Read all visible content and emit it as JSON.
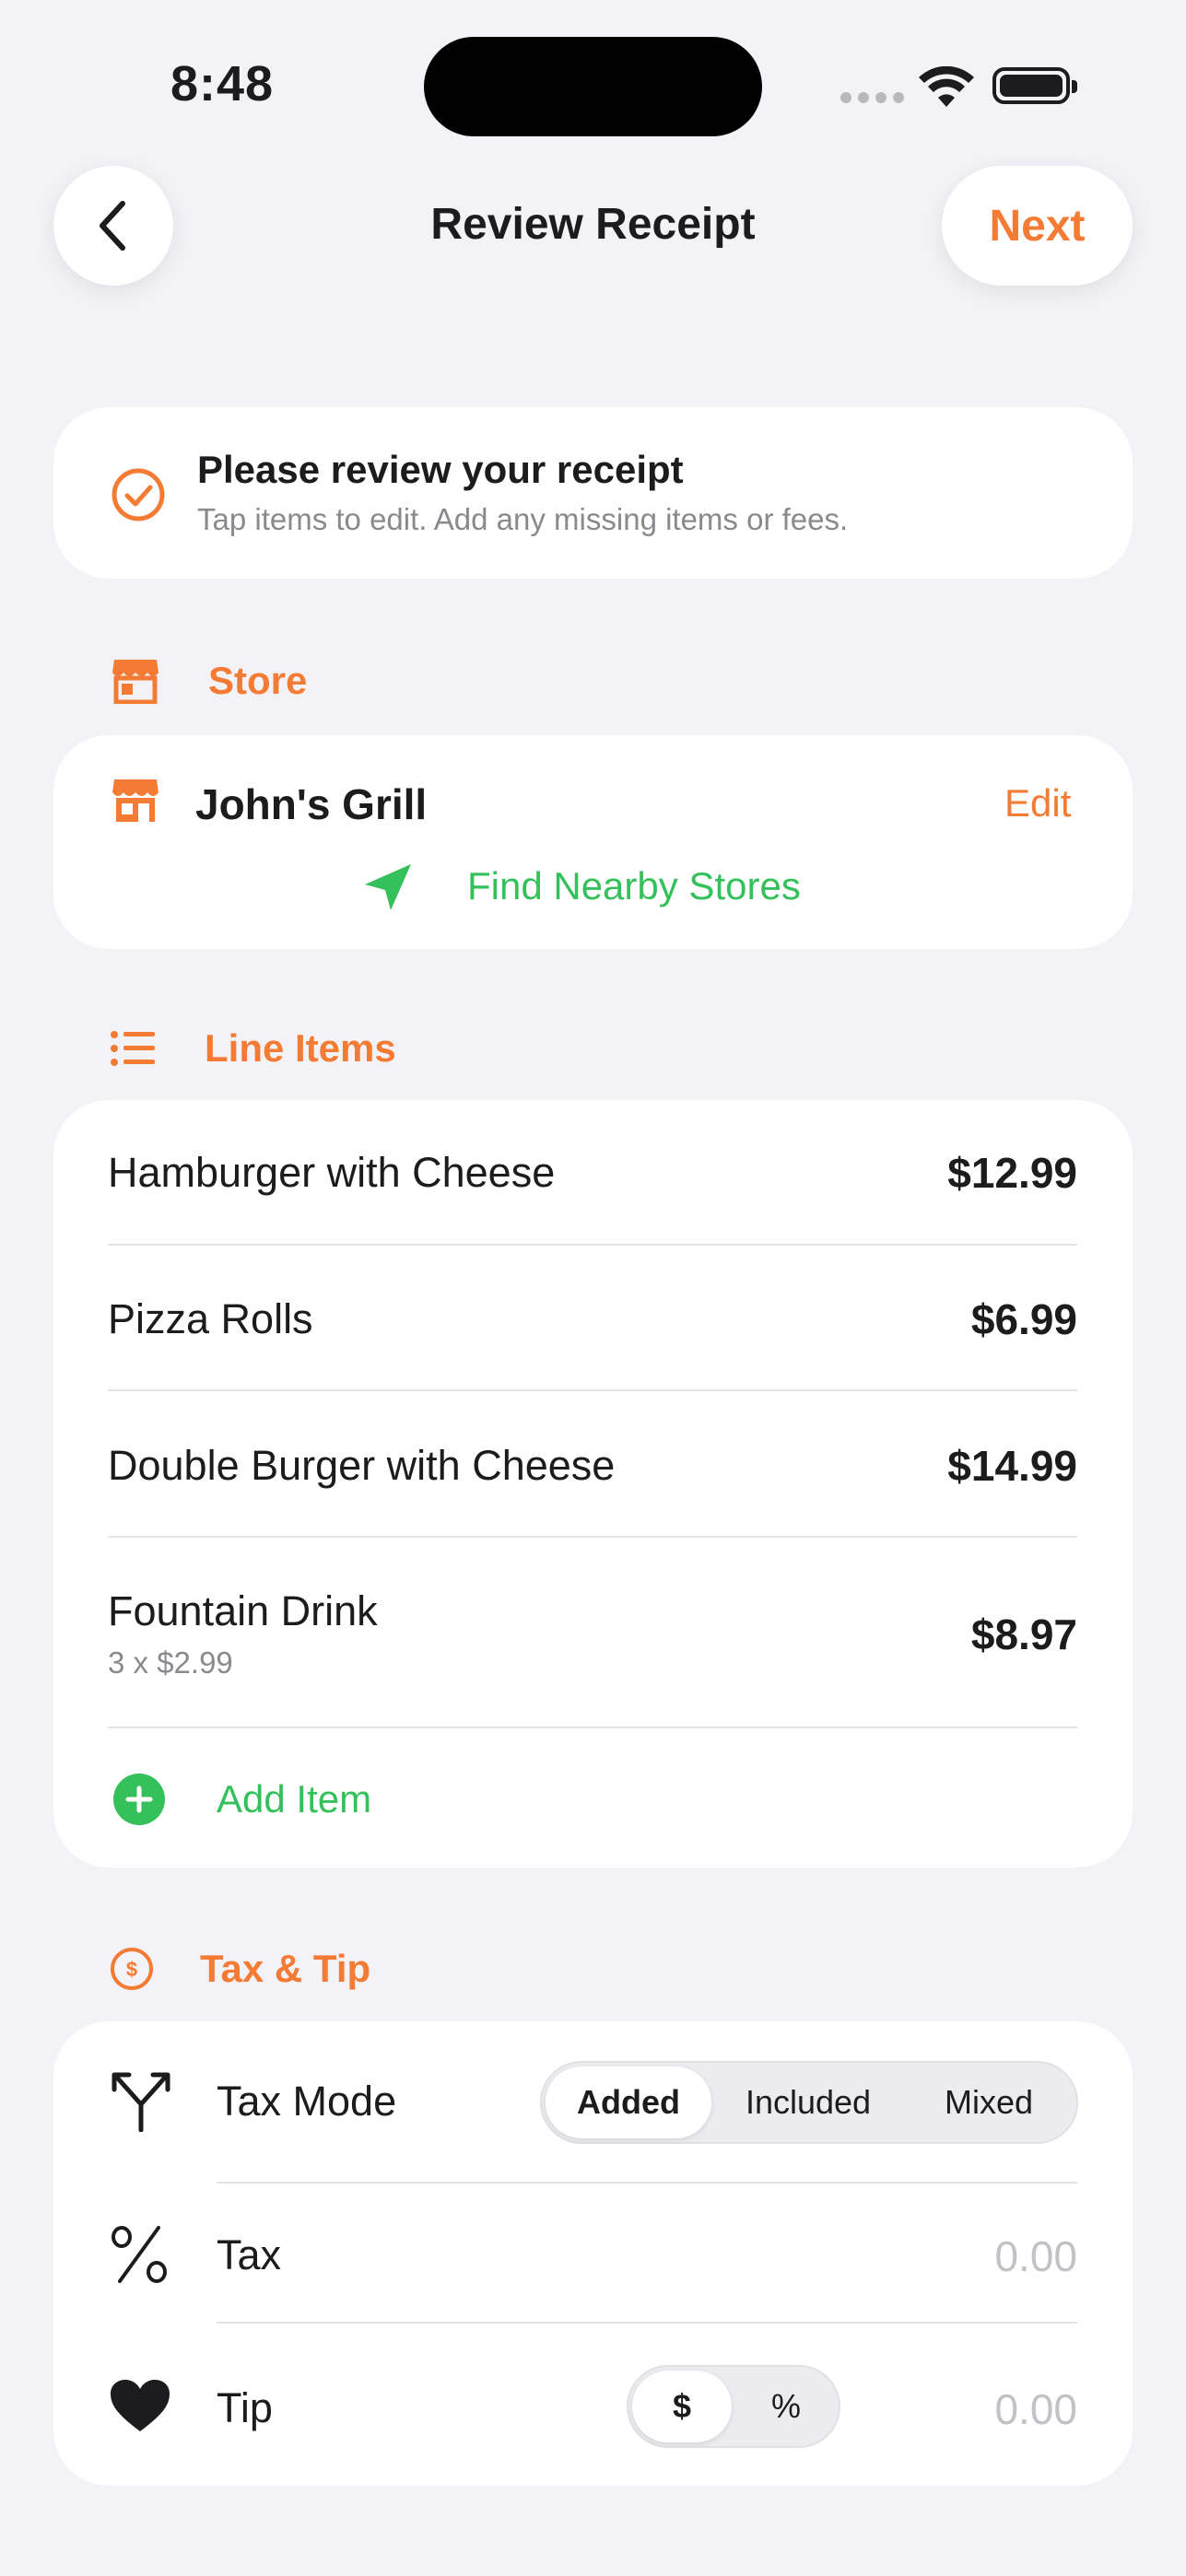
{
  "status_bar": {
    "time": "8:48"
  },
  "nav": {
    "title": "Review Receipt",
    "next_label": "Next"
  },
  "notice": {
    "title": "Please review your receipt",
    "subtitle": "Tap items to edit. Add any missing items or fees."
  },
  "store_section": {
    "label": "Store",
    "store_name": "John's Grill",
    "edit_label": "Edit",
    "find_label": "Find Nearby Stores"
  },
  "line_items_section": {
    "label": "Line Items",
    "items": [
      {
        "name": "Hamburger with Cheese",
        "price": "$12.99",
        "detail": ""
      },
      {
        "name": "Pizza Rolls",
        "price": "$6.99",
        "detail": ""
      },
      {
        "name": "Double Burger with Cheese",
        "price": "$14.99",
        "detail": ""
      },
      {
        "name": "Fountain Drink",
        "price": "$8.97",
        "detail": "3 x $2.99"
      }
    ],
    "add_label": "Add Item"
  },
  "tax_tip_section": {
    "label": "Tax & Tip",
    "tax_mode_label": "Tax Mode",
    "tax_mode_options": [
      "Added",
      "Included",
      "Mixed"
    ],
    "tax_mode_selected": "Added",
    "tax_label": "Tax",
    "tax_placeholder": "0.00",
    "tip_label": "Tip",
    "tip_options": [
      "$",
      "%"
    ],
    "tip_selected": "$",
    "tip_placeholder": "0.00"
  },
  "colors": {
    "accent": "#f47b34",
    "positive": "#34c05a",
    "background": "#f2f2f7"
  }
}
